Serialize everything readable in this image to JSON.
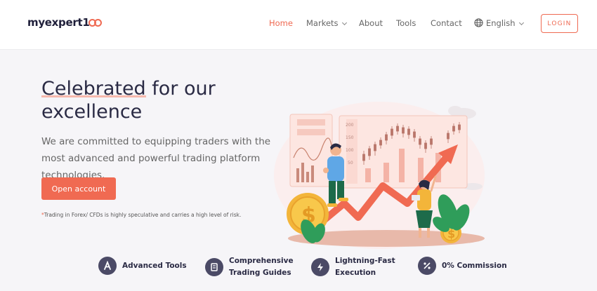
{
  "header": {
    "logo": {
      "text": "myexpert1",
      "tail": "00"
    },
    "nav": [
      {
        "label": "Home",
        "active": true
      },
      {
        "label": "Markets",
        "active": false,
        "dropdown": true
      },
      {
        "label": "About",
        "active": false
      },
      {
        "label": "Tools",
        "active": false
      },
      {
        "label": "Contact",
        "active": false
      }
    ],
    "language": {
      "label": "English",
      "icon": "globe-icon"
    },
    "login_label": "LOGIN"
  },
  "hero": {
    "title_highlight": "Celebrated",
    "title_rest": " for our excellence",
    "subtitle": "We are committed to equipping traders with the most advanced and powerful trading platform technologies.",
    "cta_label": "Open account",
    "disclaimer_star": "*",
    "disclaimer": "Trading in Forex/ CFDs is highly speculative and carries a high level of risk.",
    "illustration": {
      "chart_labels": [
        "200",
        "150",
        "100",
        "50"
      ]
    }
  },
  "features": [
    {
      "label_line1": "Advanced Tools",
      "label_line2": "",
      "icon": "tools-icon"
    },
    {
      "label_line1": "Comprehensive",
      "label_line2": "Trading Guides",
      "icon": "book-icon"
    },
    {
      "label_line1": "Lightning-Fast",
      "label_line2": "Execution",
      "icon": "lightning-icon"
    },
    {
      "label_line1": "0% Commission",
      "label_line2": "",
      "icon": "percent-icon"
    }
  ],
  "colors": {
    "accent": "#ef6a52",
    "dark": "#2a2a44",
    "icon_bg": "#4b4a66",
    "background": "#f6f5f8"
  }
}
